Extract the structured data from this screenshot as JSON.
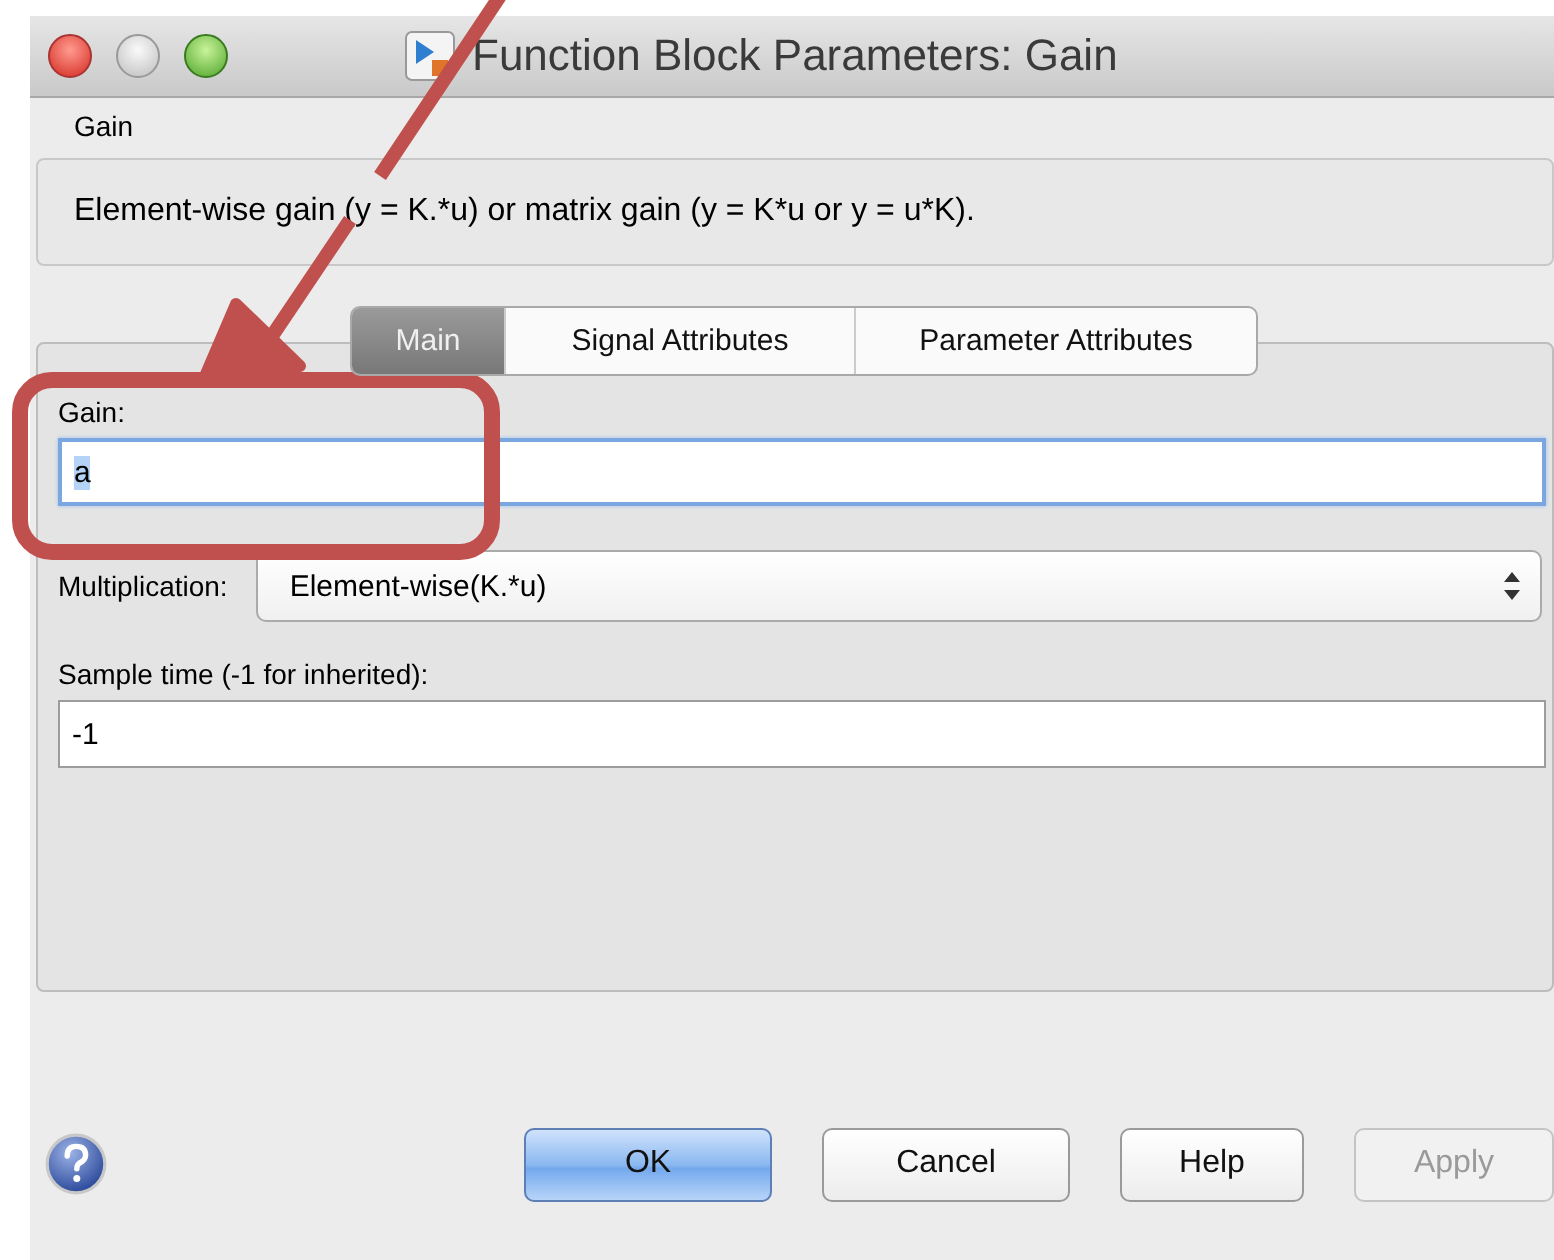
{
  "window": {
    "title": "Function Block Parameters: Gain"
  },
  "block": {
    "name": "Gain",
    "description": "Element-wise gain (y = K.*u) or matrix gain (y = K*u or y = u*K)."
  },
  "tabs": [
    {
      "label": "Main",
      "selected": true
    },
    {
      "label": "Signal Attributes",
      "selected": false
    },
    {
      "label": "Parameter Attributes",
      "selected": false
    }
  ],
  "fields": [
    {
      "kind": "text",
      "label": "Gain:",
      "value": "a",
      "focused": true
    },
    {
      "kind": "select",
      "label": "Multiplication:",
      "value": "Element-wise(K.*u)"
    },
    {
      "kind": "text",
      "label": "Sample time (-1 for inherited):",
      "value": "-1",
      "focused": false
    }
  ],
  "buttons": [
    {
      "label": "OK",
      "default": true,
      "disabled": false
    },
    {
      "label": "Cancel",
      "default": false,
      "disabled": false
    },
    {
      "label": "Help",
      "default": false,
      "disabled": false
    },
    {
      "label": "Apply",
      "default": false,
      "disabled": true
    }
  ]
}
